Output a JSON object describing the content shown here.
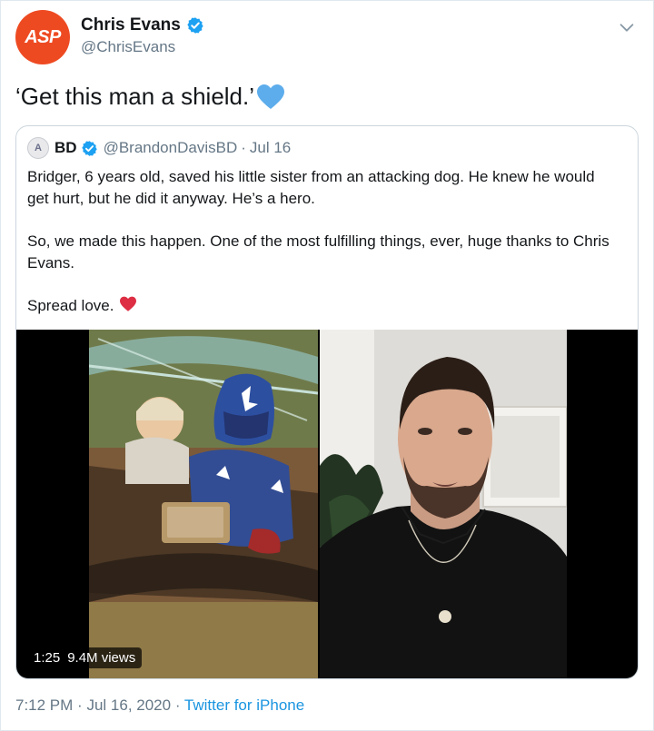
{
  "author": {
    "display_name": "Chris Evans",
    "handle": "@ChrisEvans",
    "avatar_text": "ASP",
    "avatar_color": "#ee4a22"
  },
  "tweet": {
    "text": "‘Get this man a shield.’",
    "emoji": "blue-heart-icon"
  },
  "quoted": {
    "name": "BD",
    "handle": "@BrandonDavisBD",
    "separator": "·",
    "date": "Jul 16",
    "paragraphs": [
      "Bridger, 6 years old, saved his little sister from an attacking dog. He knew he would get hurt, but he did it anyway. He’s a hero.",
      "So, we made this happen. One of the most fulfilling things, ever, huge thanks to Chris Evans.",
      "Spread love."
    ],
    "video": {
      "duration": "1:25",
      "views": "9.4M views"
    }
  },
  "footer": {
    "time": "7:12 PM",
    "sep1": "·",
    "date": "Jul 16, 2020",
    "sep2": "·",
    "source": "Twitter for iPhone"
  },
  "colors": {
    "verified": "#1da1f2",
    "link": "#1b95e0",
    "muted": "#657786"
  }
}
